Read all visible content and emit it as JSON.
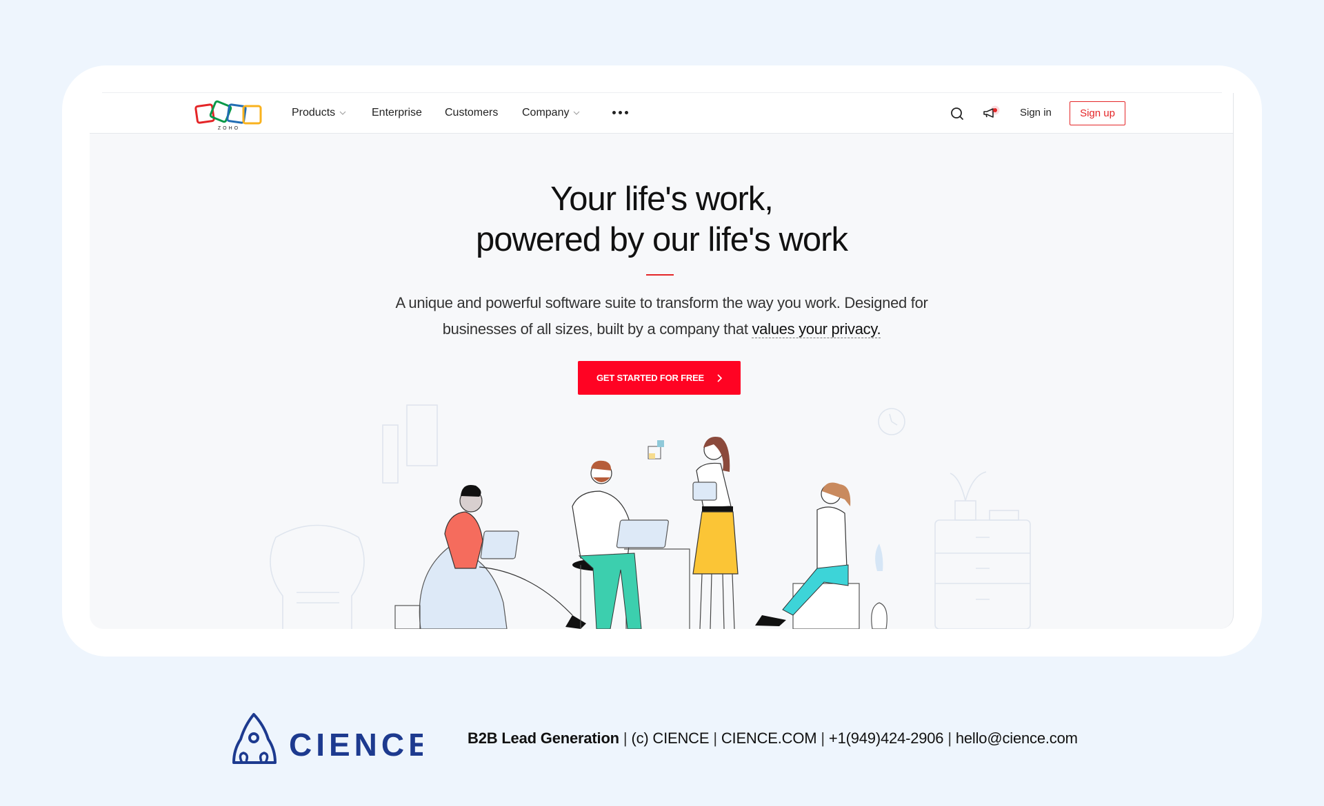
{
  "nav": {
    "logo_text": "ZOHO",
    "items": [
      {
        "label": "Products",
        "has_dropdown": true
      },
      {
        "label": "Enterprise",
        "has_dropdown": false
      },
      {
        "label": "Customers",
        "has_dropdown": false
      },
      {
        "label": "Company",
        "has_dropdown": true
      }
    ],
    "more_icon": "ellipsis-icon",
    "search_icon": "search-icon",
    "announcement_icon": "megaphone-icon",
    "sign_in": "Sign in",
    "sign_up": "Sign up"
  },
  "hero": {
    "title_line1": "Your life's work,",
    "title_line2": "powered by our life's work",
    "subtitle_line1": "A unique and powerful software suite to transform the way you work. Designed for",
    "subtitle_line2_prefix": "businesses of all sizes, built by a company that ",
    "privacy_link": "values your privacy.",
    "cta_label": "GET STARTED FOR FREE",
    "cta_icon": "chevron-right-icon"
  },
  "footer": {
    "brand": "CIENCE",
    "tagline": "B2B Lead Generation",
    "copyright": "(c) CIENCE",
    "website": "CIENCE.COM",
    "phone": "+1(949)424-2906",
    "email": "hello@cience.com"
  },
  "colors": {
    "accent_red": "#e42527",
    "cta_red": "#ff0323",
    "cience_blue": "#1d3a8f",
    "background": "#eef5fd"
  }
}
